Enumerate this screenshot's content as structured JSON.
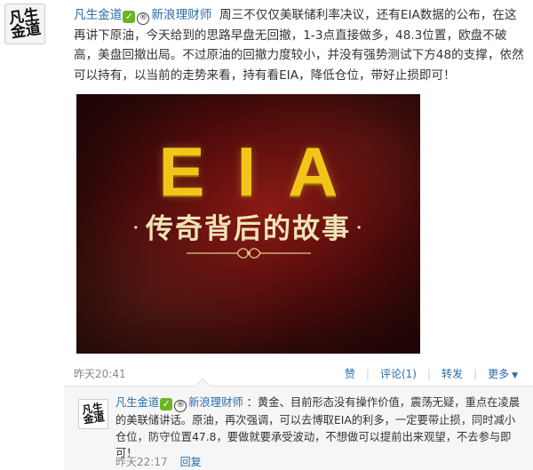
{
  "post": {
    "author": "凡生金道",
    "verified_icon": "check-verified-icon",
    "platform_badge": "®",
    "platform_name": "新浪理财师",
    "text": "周三不仅仅美联储利率决议，还有EIA数据的公布，在这再讲下原油，今天给到的思路早盘无回撤，1-3点直接做多，48.3位置，欧盘不破高，美盘回撤出局。不过原油的回撤力度较小，并没有强势测试下方48的支撑，依然可以持有，以当前的走势来看，持有看EIA，降低仓位，带好止损即可！",
    "media": {
      "title": "EIA",
      "subtitle_left_dot": "·",
      "subtitle": "传奇背后的故事",
      "subtitle_right_dot": "·"
    },
    "time": "昨天20:41",
    "actions": {
      "like": "赞",
      "comment": "评论(1)",
      "forward": "转发",
      "more": "更多"
    }
  },
  "reply": {
    "author": "凡生金道",
    "platform_badge": "®",
    "platform_name": "新浪理财师",
    "text": "：黄金、目前形态没有操作价值，震荡无疑，重点在凌晨的美联储讲话。原油，再次强调，可以去博取EIA的利多，一定要带止损，同时减小仓位，防守位置47.8，要做就要承受波动，不想做可以提前出来观望，不去参与即可！",
    "time": "昨天22:17",
    "reply_label": "回复"
  },
  "colors": {
    "link": "#2a6dac",
    "verified": "#6ab61f",
    "media_title": "#f3c51a"
  }
}
